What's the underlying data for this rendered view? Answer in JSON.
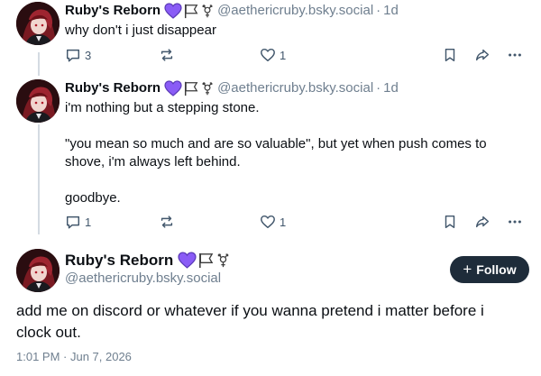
{
  "posts": [
    {
      "author": "Ruby's Reborn",
      "handle": "@aethericruby.bsky.social",
      "separator": "·",
      "age": "1d",
      "text": "why don't i just disappear",
      "reply_count": "3",
      "repost_count": "",
      "like_count": "1"
    },
    {
      "author": "Ruby's Reborn",
      "handle": "@aethericruby.bsky.social",
      "separator": "·",
      "age": "1d",
      "text": "i'm nothing but a stepping stone.\n\n\"you mean so much and are so valuable\", but yet when push comes to shove, i'm always left behind.\n\ngoodbye.",
      "reply_count": "1",
      "repost_count": "",
      "like_count": "1"
    }
  ],
  "main_post": {
    "author": "Ruby's Reborn",
    "handle": "@aethericruby.bsky.social",
    "follow_label": "Follow",
    "follow_plus": "+",
    "text": "add me on discord or whatever if you wanna pretend i matter before i clock out.",
    "timestamp": "1:01 PM · Jun 7, 2026"
  },
  "badges": [
    "purple-heart-icon",
    "nonbinary-flag-icon",
    "transgender-symbol-icon"
  ],
  "colors": {
    "accent_purple": "#8a5cf6",
    "muted_text": "#6f7f8f",
    "icon_gray": "#42576c",
    "follow_bg": "#1e2c3a",
    "thread_line": "#d4dbe2"
  }
}
